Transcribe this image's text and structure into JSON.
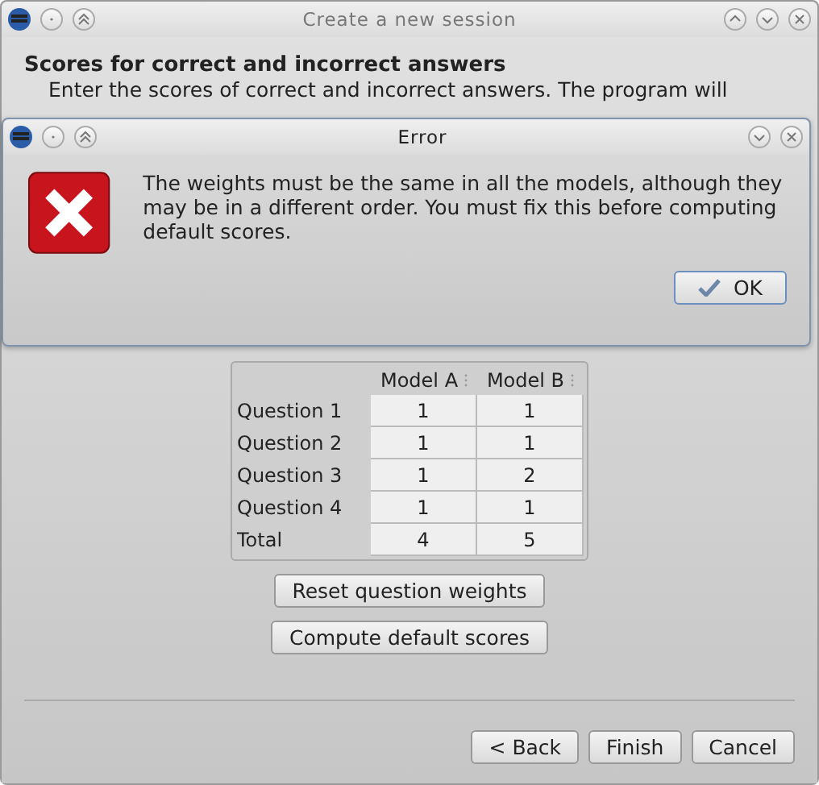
{
  "window": {
    "title": "Create a new session"
  },
  "page": {
    "heading": "Scores for correct and incorrect answers",
    "description": [
      "Enter the scores of correct and incorrect answers. The program will"
    ]
  },
  "weights": {
    "columns": [
      "Model A",
      "Model B"
    ],
    "rows": [
      {
        "label": "Question 1",
        "values": [
          "1",
          "1"
        ]
      },
      {
        "label": "Question 2",
        "values": [
          "1",
          "1"
        ]
      },
      {
        "label": "Question 3",
        "values": [
          "1",
          "2"
        ]
      },
      {
        "label": "Question 4",
        "values": [
          "1",
          "1"
        ]
      },
      {
        "label": "Total",
        "values": [
          "4",
          "5"
        ]
      }
    ]
  },
  "actions": [
    "Reset question weights",
    "Compute default scores"
  ],
  "nav_buttons": [
    {
      "label": "< Back"
    },
    {
      "label": "Finish"
    },
    {
      "label": "Cancel"
    }
  ],
  "error_dialog": {
    "title": "Error",
    "message": "The weights must be the same in all the models, although they may be in a different order. You must fix this before computing default scores.",
    "button": "OK"
  }
}
